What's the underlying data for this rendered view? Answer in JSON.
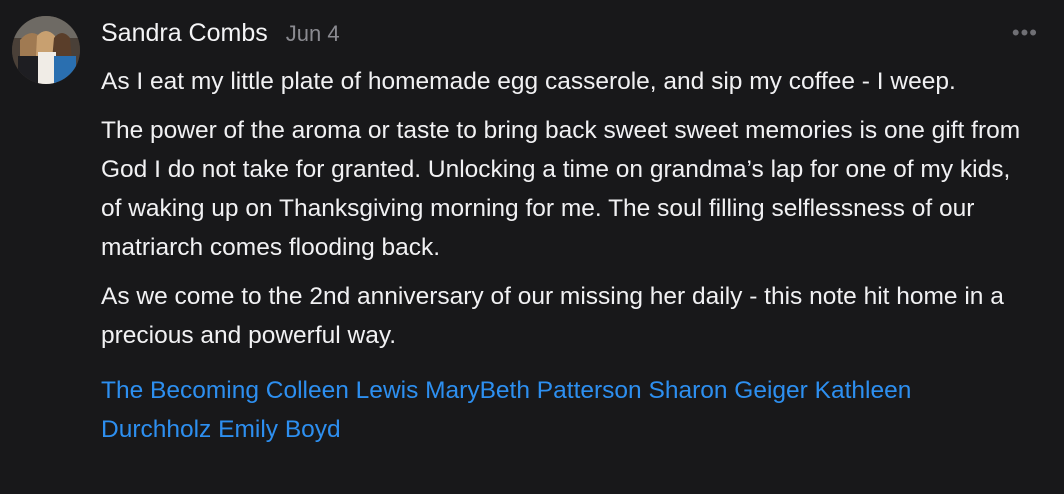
{
  "post": {
    "author": "Sandra Combs",
    "date": "Jun 4",
    "more_icon": "•••",
    "paragraphs": [
      "As I eat my little plate of homemade egg casserole, and sip my coffee - I weep.",
      "The power of the aroma or taste to bring back sweet sweet memories is one gift from God I do not take for granted. Unlocking a time on grandma’s lap for one of my kids, of waking up on Thanksgiving morning for me. The soul filling selflessness of our matriarch comes flooding back.",
      "As we come to the 2nd anniversary of our missing her daily - this note hit home in a precious and powerful way."
    ],
    "mentions": [
      "The Becoming",
      "Colleen Lewis",
      "MaryBeth Patterson",
      "Sharon Geiger",
      "Kathleen Durchholz",
      "Emily Boyd"
    ]
  },
  "colors": {
    "background": "#18181a",
    "text": "#f1f1f3",
    "muted": "#8a8a90",
    "link": "#2d8ff0"
  }
}
